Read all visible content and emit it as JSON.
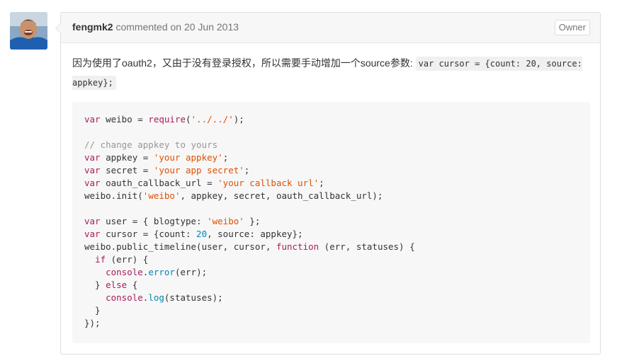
{
  "comment": {
    "author": "fengmk2",
    "action": "commented on",
    "date": "20 Jun 2013",
    "badge": "Owner",
    "body_text": "因为使用了oauth2，又由于没有登录授权，所以需要手动增加一个source参数:",
    "inline_code": "var cursor = {count: 20, source: appkey};"
  },
  "code": {
    "lines": [
      "var weibo = require('../../');",
      "",
      "// change appkey to yours",
      "var appkey = 'your appkey';",
      "var secret = 'your app secret';",
      "var oauth_callback_url = 'your callback url';",
      "weibo.init('weibo', appkey, secret, oauth_callback_url);",
      "",
      "var user = { blogtype: 'weibo' };",
      "var cursor = {count: 20, source: appkey};",
      "weibo.public_timeline(user, cursor, function (err, statuses) {",
      "  if (err) {",
      "    console.error(err);",
      "  } else {",
      "    console.log(statuses);",
      "  }",
      "});"
    ]
  },
  "colors": {
    "keyword": "#a71d5d",
    "string": "#df5000",
    "comment": "#969896",
    "number": "#0086b3",
    "header_bg": "#f7f7f7",
    "border": "#dddddd"
  },
  "icons": {
    "avatar": "user-avatar-photo"
  }
}
